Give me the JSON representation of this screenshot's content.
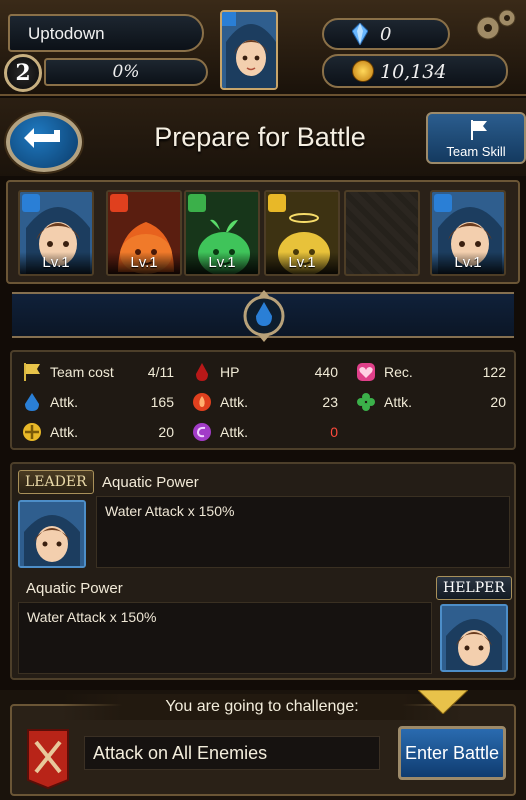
{
  "player": {
    "name": "Uptodown",
    "level": "2",
    "exp_percent": "0%",
    "gems": "0",
    "gold": "10,134"
  },
  "header": {
    "title": "Prepare for Battle",
    "team_skill_label": "Team Skill"
  },
  "party": [
    {
      "name": "leader-hero",
      "level": "Lv.1",
      "attribute": "water"
    },
    {
      "name": "fire-slime",
      "level": "Lv.1",
      "attribute": "fire"
    },
    {
      "name": "wood-slime",
      "level": "Lv.1",
      "attribute": "wood"
    },
    {
      "name": "light-slime",
      "level": "Lv.1",
      "attribute": "light"
    },
    {
      "name": "empty",
      "level": "",
      "attribute": "none"
    },
    {
      "name": "helper-hero",
      "level": "Lv.1",
      "attribute": "water"
    }
  ],
  "stats": {
    "team_cost_label": "Team cost",
    "team_cost_value": "4/11",
    "hp_label": "HP",
    "hp_value": "440",
    "rec_label": "Rec.",
    "rec_value": "122",
    "water_attk_label": "Attk.",
    "water_attk_value": "165",
    "fire_attk_label": "Attk.",
    "fire_attk_value": "23",
    "wood_attk_label": "Attk.",
    "wood_attk_value": "20",
    "light_attk_label": "Attk.",
    "light_attk_value": "20",
    "dark_attk_label": "Attk.",
    "dark_attk_value": "0"
  },
  "leader": {
    "tag": "LEADER",
    "skill_name": "Aquatic Power",
    "skill_desc": "Water Attack x 150%"
  },
  "helper": {
    "tag": "HELPER",
    "skill_name": "Aquatic Power",
    "skill_desc": "Water Attack x 150%"
  },
  "challenge": {
    "caption": "You are going to challenge:",
    "target": "Attack on All Enemies",
    "enter_label": "Enter Battle"
  },
  "colors": {
    "water": "#2a7fd6",
    "fire": "#e0401e",
    "wood": "#3bb04a",
    "light": "#e8b828",
    "dark": "#a23cc8",
    "heart": "#e0408a"
  }
}
